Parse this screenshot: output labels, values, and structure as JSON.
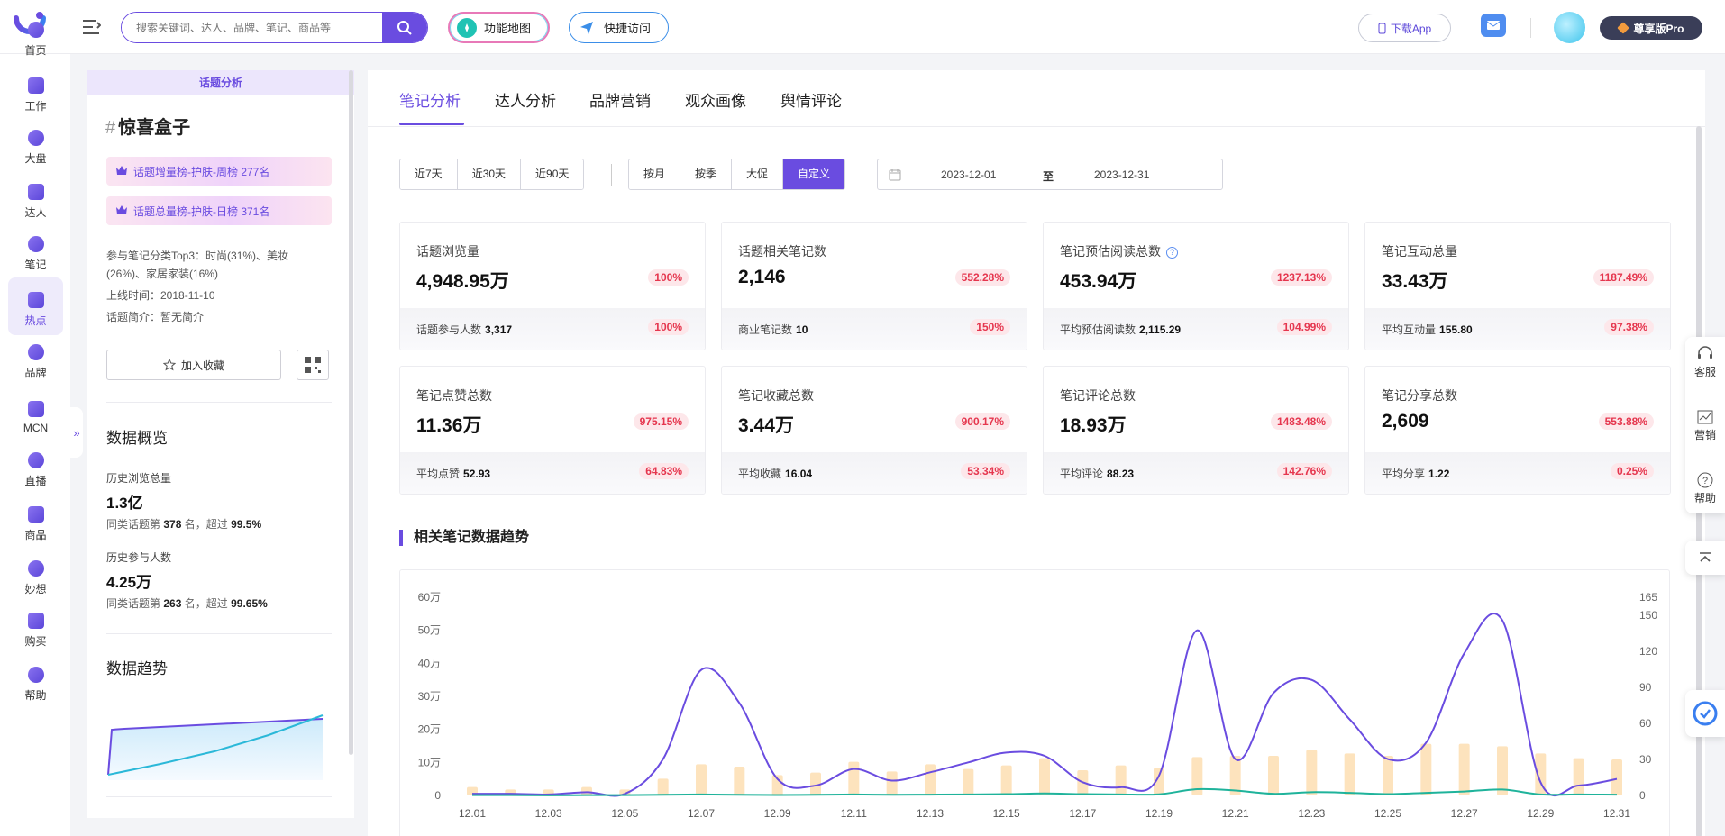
{
  "header": {
    "search_placeholder": "搜索关键词、达人、品牌、笔记、商品等",
    "function_map": "功能地图",
    "quick_access": "快捷访问",
    "download_app": "下载App",
    "pro_label": "尊享版Pro"
  },
  "sidebar": {
    "items": [
      {
        "label": "首页",
        "icon": "home-icon"
      },
      {
        "label": "工作",
        "icon": "work-icon"
      },
      {
        "label": "大盘",
        "icon": "pie-chart-icon"
      },
      {
        "label": "达人",
        "icon": "person-icon"
      },
      {
        "label": "笔记",
        "icon": "note-icon"
      },
      {
        "label": "热点",
        "icon": "fire-icon",
        "active": true
      },
      {
        "label": "品牌",
        "icon": "brand-icon"
      },
      {
        "label": "MCN",
        "icon": "mcn-icon"
      },
      {
        "label": "直播",
        "icon": "live-icon"
      },
      {
        "label": "商品",
        "icon": "goods-icon"
      },
      {
        "label": "妙想",
        "icon": "bulb-icon"
      },
      {
        "label": "购买",
        "icon": "cart-icon"
      },
      {
        "label": "帮助",
        "icon": "help-icon"
      }
    ]
  },
  "left": {
    "header": "话题分析",
    "topic_name": "惊喜盒子",
    "rank1": "话题增量榜-护肤-周榜 277名",
    "rank2": "话题总量榜-护肤-日榜 371名",
    "category_line1": "参与笔记分类Top3：时尚(31%)、美妆",
    "category_line2": "(26%)、家居家装(16%)",
    "online_time": "上线时间：2018-11-10",
    "intro": "话题简介：暂无简介",
    "favorite": "加入收藏",
    "overview_title": "数据概览",
    "hist_views_label": "历史浏览总量",
    "hist_views_value": "1.3亿",
    "hist_views_rank_prefix": "同类话题第",
    "hist_views_rank": "378",
    "hist_views_rank_mid": "名，超过",
    "hist_views_pct": "99.5%",
    "hist_users_label": "历史参与人数",
    "hist_users_value": "4.25万",
    "hist_users_rank_prefix": "同类话题第",
    "hist_users_rank": "263",
    "hist_users_rank_mid": "名，超过",
    "hist_users_pct": "99.65%",
    "trend_title": "数据趋势"
  },
  "tabs": [
    "笔记分析",
    "达人分析",
    "品牌营销",
    "观众画像",
    "舆情评论"
  ],
  "filters": {
    "quick": [
      "近7天",
      "近30天",
      "近90天"
    ],
    "period": [
      "按月",
      "按季",
      "大促",
      "自定义"
    ],
    "date_start": "2023-12-01",
    "date_sep": "至",
    "date_end": "2023-12-31"
  },
  "kpis": [
    {
      "label": "话题浏览量",
      "value": "4,948.95万",
      "pct": "100%",
      "sub_label": "话题参与人数",
      "sub_value": "3,317",
      "sub_pct": "100%"
    },
    {
      "label": "话题相关笔记数",
      "value": "2,146",
      "pct": "552.28%",
      "sub_label": "商业笔记数",
      "sub_value": "10",
      "sub_pct": "150%"
    },
    {
      "label": "笔记预估阅读总数",
      "value": "453.94万",
      "pct": "1237.13%",
      "sub_label": "平均预估阅读数",
      "sub_value": "2,115.29",
      "sub_pct": "104.99%",
      "help": true
    },
    {
      "label": "笔记互动总量",
      "value": "33.43万",
      "pct": "1187.49%",
      "sub_label": "平均互动量",
      "sub_value": "155.80",
      "sub_pct": "97.38%"
    },
    {
      "label": "笔记点赞总数",
      "value": "11.36万",
      "pct": "975.15%",
      "sub_label": "平均点赞",
      "sub_value": "52.93",
      "sub_pct": "64.83%"
    },
    {
      "label": "笔记收藏总数",
      "value": "3.44万",
      "pct": "900.17%",
      "sub_label": "平均收藏",
      "sub_value": "16.04",
      "sub_pct": "53.34%"
    },
    {
      "label": "笔记评论总数",
      "value": "18.93万",
      "pct": "1483.48%",
      "sub_label": "平均评论",
      "sub_value": "88.23",
      "sub_pct": "142.76%"
    },
    {
      "label": "笔记分享总数",
      "value": "2,609",
      "pct": "553.88%",
      "sub_label": "平均分享",
      "sub_value": "1.22",
      "sub_pct": "0.25%"
    }
  ],
  "chart_section_title": "相关笔记数据趋势",
  "float_panel": {
    "service": "客服",
    "marketing": "营销",
    "help": "帮助"
  },
  "colors": {
    "accent": "#6a4ce0",
    "bar": "#fde3bd",
    "line1": "#6a4ce0",
    "line2": "#1fb39b",
    "danger": "#e5364e"
  },
  "chart_data": {
    "type": "bar",
    "categories": [
      "12.01",
      "12.02",
      "12.03",
      "12.04",
      "12.05",
      "12.06",
      "12.07",
      "12.08",
      "12.09",
      "12.10",
      "12.11",
      "12.12",
      "12.13",
      "12.14",
      "12.15",
      "12.16",
      "12.17",
      "12.18",
      "12.19",
      "12.20",
      "12.21",
      "12.22",
      "12.23",
      "12.24",
      "12.25",
      "12.26",
      "12.27",
      "12.28",
      "12.29",
      "12.30",
      "12.31"
    ],
    "x_tick_labels": [
      "12.01",
      "12.03",
      "12.05",
      "12.07",
      "12.09",
      "12.11",
      "12.13",
      "12.15",
      "12.17",
      "12.19",
      "12.21",
      "12.23",
      "12.25",
      "12.27",
      "12.29",
      "12.31"
    ],
    "series": [
      {
        "axis": "right",
        "type": "bar",
        "values": [
          7,
          5,
          5,
          7,
          5,
          14,
          26,
          24,
          17,
          19,
          28,
          20,
          26,
          22,
          25,
          31,
          21,
          25,
          23,
          32,
          33,
          33,
          38,
          35,
          33,
          43,
          43,
          41,
          35,
          31,
          30
        ]
      },
      {
        "axis": "left",
        "type": "line",
        "values": [
          5000,
          5000,
          3000,
          10000,
          5000,
          110000,
          380000,
          280000,
          50000,
          30000,
          80000,
          45000,
          70000,
          100000,
          130000,
          120000,
          40000,
          25000,
          60000,
          500000,
          110000,
          310000,
          350000,
          230000,
          110000,
          160000,
          430000,
          530000,
          40000,
          30000,
          50000
        ]
      },
      {
        "axis": "left",
        "type": "line",
        "values": [
          1000,
          1000,
          500,
          1000,
          1000,
          2000,
          3000,
          2000,
          1500,
          2000,
          3000,
          2000,
          2500,
          3000,
          4000,
          6000,
          4000,
          3000,
          3500,
          19000,
          15000,
          5000,
          10000,
          8000,
          4000,
          8000,
          12000,
          18000,
          3000,
          3000,
          2500
        ]
      }
    ],
    "y_left_ticks": [
      "0",
      "10万",
      "20万",
      "30万",
      "40万",
      "50万",
      "60万"
    ],
    "y_right_ticks": [
      "0",
      "30",
      "60",
      "90",
      "120",
      "150",
      "165"
    ],
    "ylim_left": [
      0,
      600000
    ],
    "ylim_right": [
      0,
      165
    ],
    "grid": false
  }
}
